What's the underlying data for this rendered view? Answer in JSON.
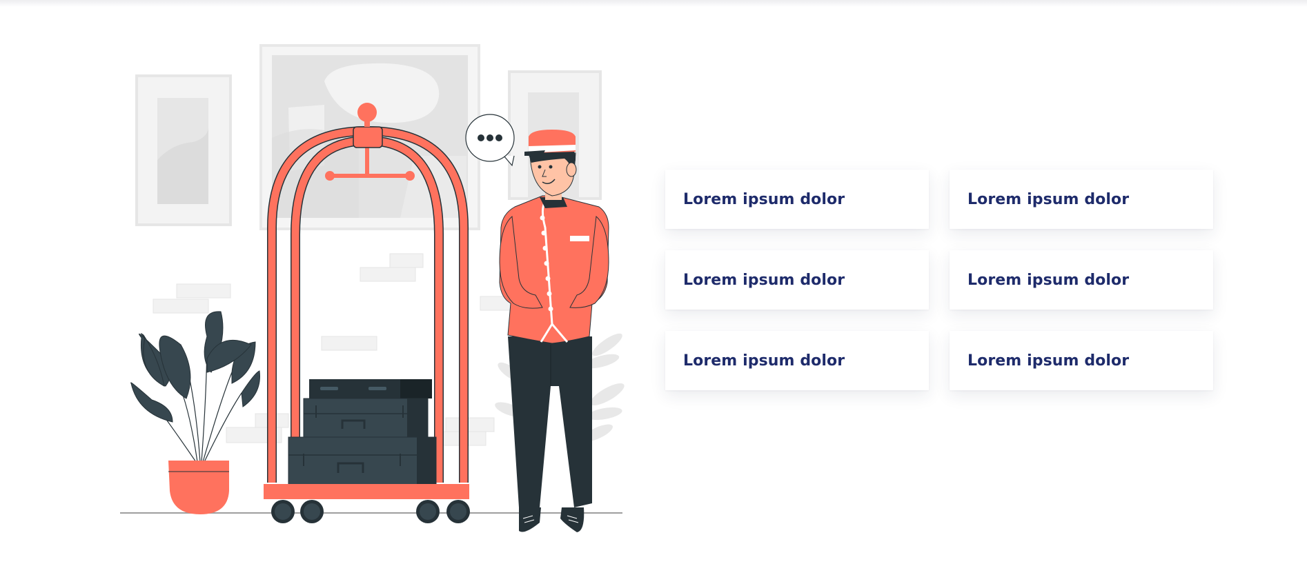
{
  "features": [
    {
      "label": "Lorem ipsum dolor"
    },
    {
      "label": "Lorem ipsum dolor"
    },
    {
      "label": "Lorem ipsum dolor"
    },
    {
      "label": "Lorem ipsum dolor"
    },
    {
      "label": "Lorem ipsum dolor"
    },
    {
      "label": "Lorem ipsum dolor"
    }
  ],
  "illustration": {
    "name": "bellhop-with-luggage-cart",
    "speech_bubble_text": "•••"
  },
  "colors": {
    "accent": "#ff725e",
    "dark": "#263238",
    "slate": "#37474f",
    "navy_text": "#1e2b6b",
    "light_gray": "#ebebeb"
  }
}
